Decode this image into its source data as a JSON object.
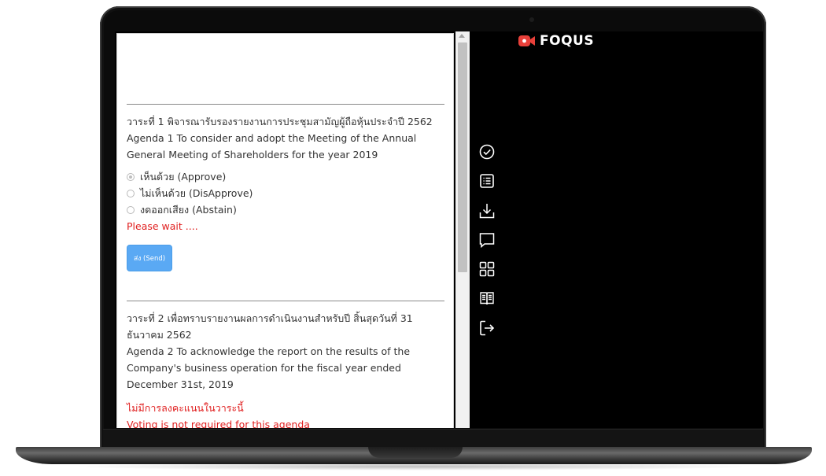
{
  "app": {
    "logo_text": "FOQUS",
    "brand_color": "#e8403a"
  },
  "agendas": [
    {
      "title_th": "วาระที่ 1 พิจารณารับรองรายงานการประชุมสามัญผู้ถือหุ้นประจำปี 2562",
      "title_en": "Agenda 1 To consider and adopt the Meeting of the Annual General Meeting of Shareholders for the year 2019",
      "options": [
        {
          "label": "เห็นด้วย (Approve)",
          "checked": true
        },
        {
          "label": "ไม่เห็นด้วย (DisApprove)",
          "checked": false
        },
        {
          "label": "งดออกเสียง (Abstain)",
          "checked": false
        }
      ],
      "status": "Please wait ....",
      "send_label": "ส่ง (Send)"
    },
    {
      "title_th": "วาระที่ 2 เพื่อทราบรายงานผลการดำเนินงานสำหรับปี สิ้นสุดวันที่ 31 ธันวาคม 2562",
      "title_en": "Agenda 2 To acknowledge the report on the results of the Company's business operation for the fiscal year ended December 31st, 2019",
      "notice_th": "ไม่มีการลงคะแนนในวาระนี้",
      "notice_en": "Voting is not required for this agenda"
    }
  ],
  "sidebar": {
    "icons": [
      "check-circle-icon",
      "list-icon",
      "download-icon",
      "chat-icon",
      "grid-icon",
      "book-icon",
      "logout-icon"
    ]
  },
  "colors": {
    "accent": "#5aa9f4",
    "warning": "#e02020"
  }
}
